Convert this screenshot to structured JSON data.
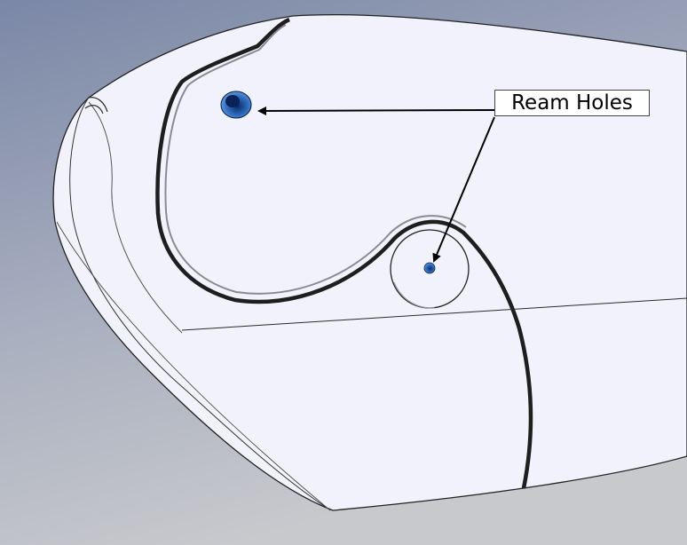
{
  "viewport": {
    "background_top": "#7d8aa8",
    "background_bottom": "#c4c6cc"
  },
  "part": {
    "surface_color": "#f1f1fd",
    "edge_color": "#1f1f1f",
    "hole_color": "#2f6fc0"
  },
  "callout": {
    "label": "Ream Holes"
  }
}
